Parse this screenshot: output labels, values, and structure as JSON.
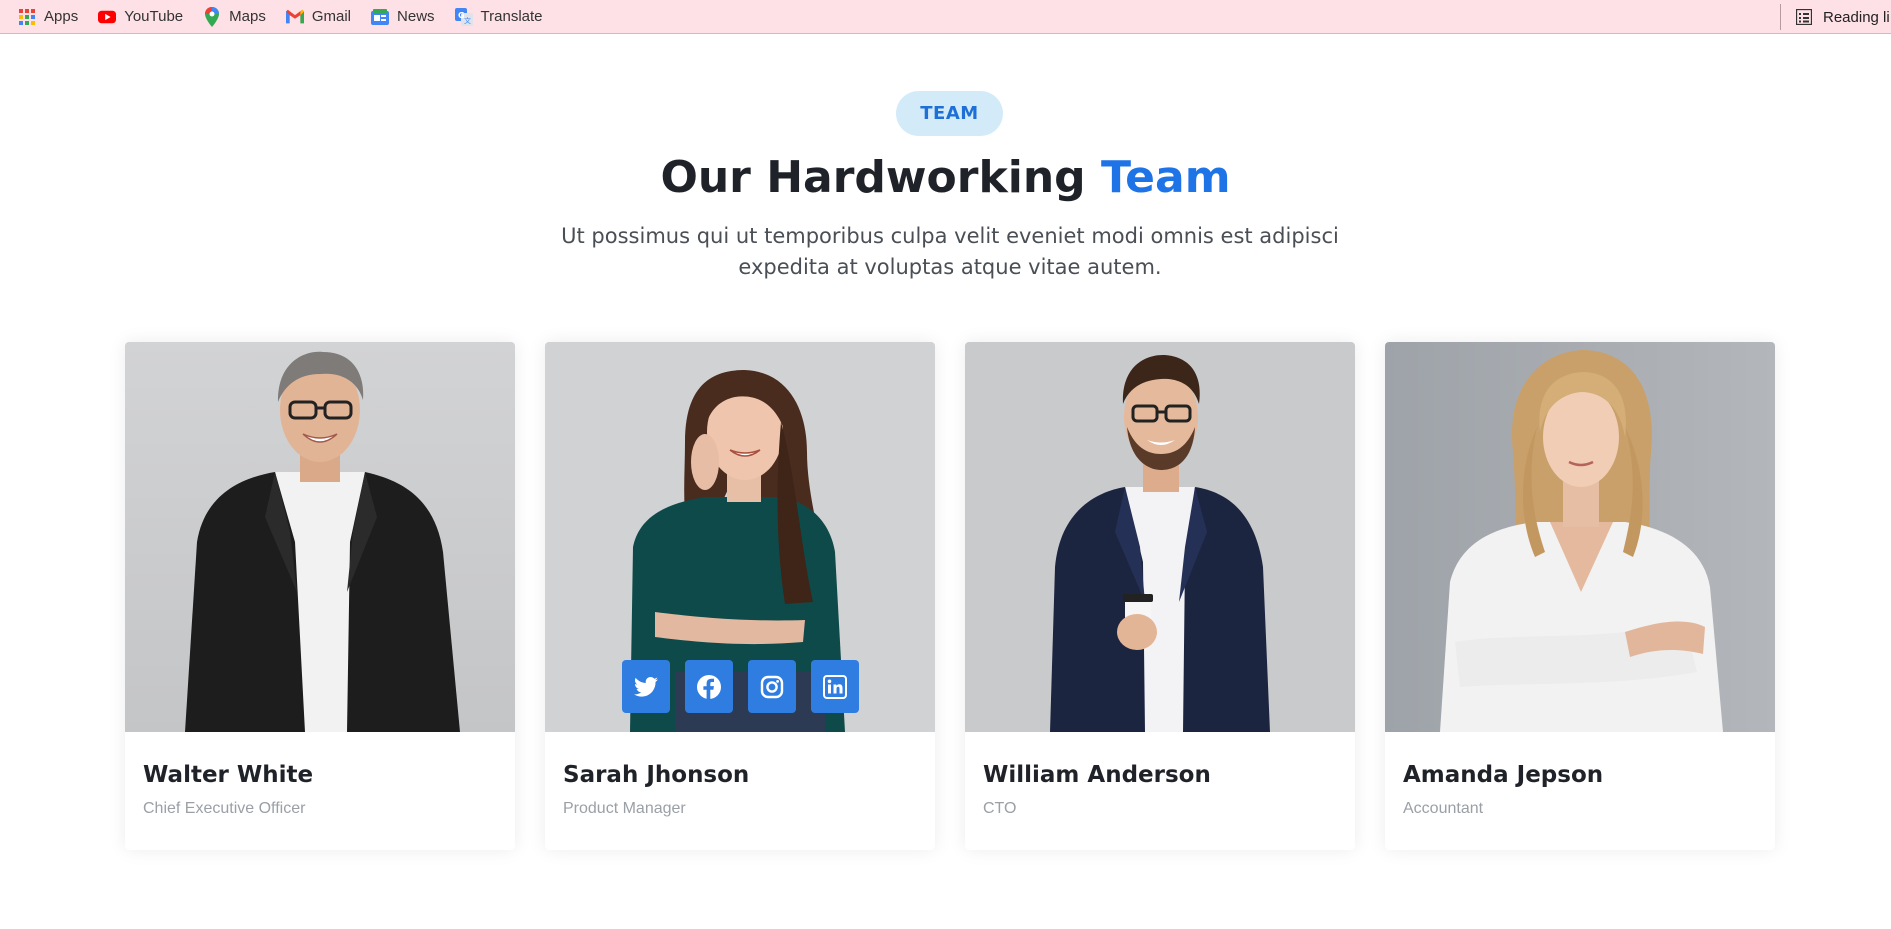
{
  "bookmarks": [
    {
      "label": "Apps",
      "icon": "apps-grid-icon"
    },
    {
      "label": "YouTube",
      "icon": "youtube-icon"
    },
    {
      "label": "Maps",
      "icon": "maps-pin-icon"
    },
    {
      "label": "Gmail",
      "icon": "gmail-icon"
    },
    {
      "label": "News",
      "icon": "news-icon"
    },
    {
      "label": "Translate",
      "icon": "translate-icon"
    }
  ],
  "reading_list": {
    "label": "Reading li",
    "icon": "reading-list-icon"
  },
  "section": {
    "badge": "TEAM",
    "title_main": "Our Hardworking",
    "title_accent": "Team",
    "subtitle": "Ut possimus qui ut temporibus culpa velit eveniet modi omnis est adipisci expedita at voluptas atque vitae autem."
  },
  "team": [
    {
      "name": "Walter White",
      "role": "Chief Executive Officer"
    },
    {
      "name": "Sarah Jhonson",
      "role": "Product Manager"
    },
    {
      "name": "William Anderson",
      "role": "CTO"
    },
    {
      "name": "Amanda Jepson",
      "role": "Accountant"
    }
  ],
  "social_icons": [
    "twitter-icon",
    "facebook-icon",
    "instagram-icon",
    "linkedin-icon"
  ],
  "colors": {
    "accent": "#1e73e6",
    "badge_bg": "#d3ebf9",
    "social_bg": "#2f7de1",
    "bookmarks_bg": "#fde1e6"
  }
}
